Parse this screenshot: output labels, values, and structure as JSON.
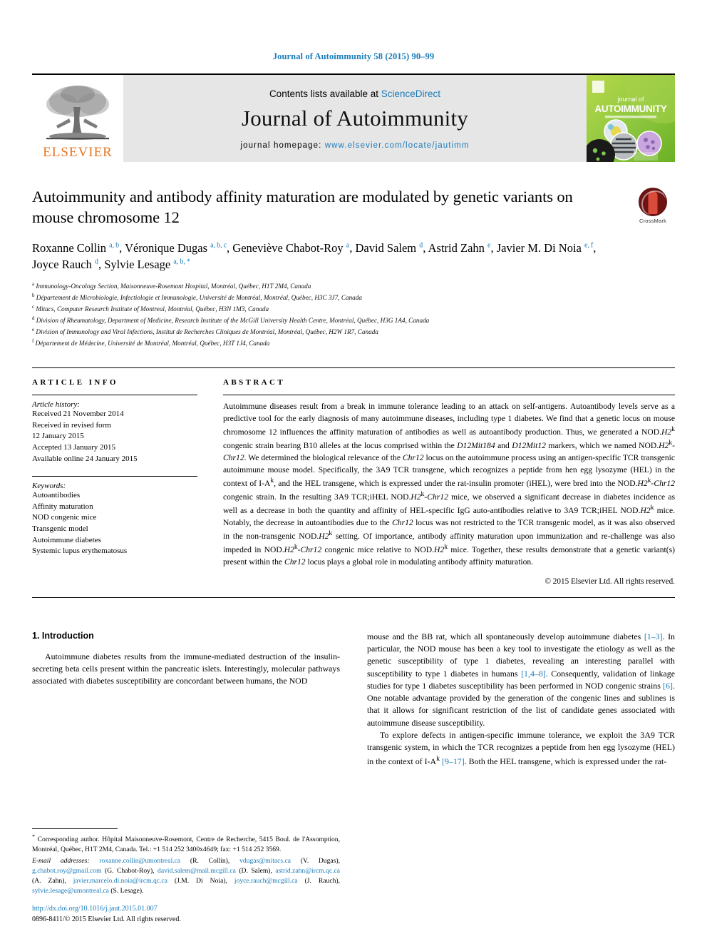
{
  "running_head": "Journal of Autoimmunity 58 (2015) 90–99",
  "masthead": {
    "contents_prefix": "Contents lists available at ",
    "sciencedirect": "ScienceDirect",
    "journal_title": "Journal of Autoimmunity",
    "homepage_prefix": "journal homepage: ",
    "homepage_url": "www.elsevier.com/locate/jautimm",
    "publisher": "ELSEVIER",
    "cover_line1": "journal of",
    "cover_line2": "AUTOIMMUNITY"
  },
  "article": {
    "title": "Autoimmunity and antibody affinity maturation are modulated by genetic variants on mouse chromosome 12",
    "crossmark_label": "CrossMark",
    "authors_html": "Roxanne Collin <sup>a, b</sup>, Véronique Dugas <sup>a, b, c</sup>, Geneviève Chabot-Roy <sup>a</sup>, David Salem <sup>d</sup>, Astrid Zahn <sup>e</sup>, Javier M. Di Noia <sup>e, f</sup>, Joyce Rauch <sup>d</sup>, Sylvie Lesage <sup>a, b, *</sup>",
    "affiliations": [
      {
        "mark": "a",
        "text": "Immunology-Oncology Section, Maisonneuve-Rosemont Hospital, Montréal, Québec, H1T 2M4, Canada"
      },
      {
        "mark": "b",
        "text": "Département de Microbiologie, Infectiologie et Immunologie, Université de Montréal, Montréal, Québec, H3C 3J7, Canada"
      },
      {
        "mark": "c",
        "text": "Mitacs, Computer Research Institute of Montreal, Montréal, Québec, H3N 1M3, Canada"
      },
      {
        "mark": "d",
        "text": "Division of Rheumatology, Department of Medicine, Research Institute of the McGill University Health Centre, Montréal, Québec, H3G 1A4, Canada"
      },
      {
        "mark": "e",
        "text": "Division of Immunology and Viral Infections, Institut de Recherches Cliniques de Montréal, Montréal, Québec, H2W 1R7, Canada"
      },
      {
        "mark": "f",
        "text": "Département de Médecine, Université de Montréal, Montréal, Québec, H3T 1J4, Canada"
      }
    ]
  },
  "article_info": {
    "heading": "ARTICLE INFO",
    "history_label": "Article history:",
    "history": [
      "Received 21 November 2014",
      "Received in revised form",
      "12 January 2015",
      "Accepted 13 January 2015",
      "Available online 24 January 2015"
    ],
    "keywords_label": "Keywords:",
    "keywords": [
      "Autoantibodies",
      "Affinity maturation",
      "NOD congenic mice",
      "Transgenic model",
      "Autoimmune diabetes",
      "Systemic lupus erythematosus"
    ]
  },
  "abstract": {
    "heading": "ABSTRACT",
    "body_html": "Autoimmune diseases result from a break in immune tolerance leading to an attack on self-antigens. Autoantibody levels serve as a predictive tool for the early diagnosis of many autoimmune diseases, including type 1 diabetes. We find that a genetic locus on mouse chromosome 12 influences the affinity maturation of antibodies as well as autoantibody production. Thus, we generated a NOD.<i>H2</i><sup>k</sup> congenic strain bearing B10 alleles at the locus comprised within the <i>D12Mit184</i> and <i>D12Mit12</i> markers, which we named NOD.<i>H2</i><sup>k</sup>-<i>Chr12</i>. We determined the biological relevance of the <i>Chr12</i> locus on the autoimmune process using an antigen-specific TCR transgenic autoimmune mouse model. Specifically, the 3A9 TCR transgene, which recognizes a peptide from hen egg lysozyme (HEL) in the context of I-A<sup>k</sup>, and the HEL transgene, which is expressed under the rat-insulin promoter (iHEL), were bred into the NOD.<i>H2</i><sup>k</sup>-<i>Chr12</i> congenic strain. In the resulting 3A9 TCR;iHEL NOD.<i>H2</i><sup>k</sup>-<i>Chr12</i> mice, we observed a significant decrease in diabetes incidence as well as a decrease in both the quantity and affinity of HEL-specific IgG auto-antibodies relative to 3A9 TCR;iHEL NOD.<i>H2</i><sup>k</sup> mice. Notably, the decrease in autoantibodies due to the <i>Chr12</i> locus was not restricted to the TCR transgenic model, as it was also observed in the non-transgenic NOD.<i>H2</i><sup>k</sup> setting. Of importance, antibody affinity maturation upon immunization and re-challenge was also impeded in NOD.<i>H2</i><sup>k</sup>-<i>Chr12</i> congenic mice relative to NOD.<i>H2</i><sup>k</sup> mice. Together, these results demonstrate that a genetic variant(s) present within the <i>Chr12</i> locus plays a global role in modulating antibody affinity maturation.",
    "copyright": "© 2015 Elsevier Ltd. All rights reserved."
  },
  "introduction": {
    "heading": "1. Introduction",
    "left_paragraph_html": "Autoimmune diabetes results from the immune-mediated destruction of the insulin-secreting beta cells present within the pancreatic islets. Interestingly, molecular pathways associated with diabetes susceptibility are concordant between humans, the NOD",
    "right_paragraph1_html": "mouse and the BB rat, which all spontaneously develop autoimmune diabetes <span class=\"ref\">[1–3]</span>. In particular, the NOD mouse has been a key tool to investigate the etiology as well as the genetic susceptibility of type 1 diabetes, revealing an interesting parallel with susceptibility to type 1 diabetes in humans <span class=\"ref\">[1,4–8]</span>. Consequently, validation of linkage studies for type 1 diabetes susceptibility has been performed in NOD congenic strains <span class=\"ref\">[6]</span>. One notable advantage provided by the generation of the congenic lines and sublines is that it allows for significant restriction of the list of candidate genes associated with autoimmune disease susceptibility.",
    "right_paragraph2_html": "To explore defects in antigen-specific immune tolerance, we exploit the 3A9 TCR transgenic system, in which the TCR recognizes a peptide from hen egg lysozyme (HEL) in the context of I-A<sup>k</sup> <span class=\"ref\">[9–17]</span>. Both the HEL transgene, which is expressed under the rat-"
  },
  "footnote": {
    "corresponding_html": "<span class=\"ast\">*</span> Corresponding author. Hôpital Maisonneuve-Rosemont, Centre de Recherche, 5415 Boul. de l'Assomption, Montréal, Québec, H1T 2M4, Canada. Tel.: +1 514 252 3400x4649; fax: +1 514 252 3569.",
    "emails_html": "<span class=\"fn-em\">E-mail addresses:</span> <span class=\"mail\">roxanne.collin@umontreal.ca</span> (R. Collin), <span class=\"mail\">vdugas@mitacs.ca</span> (V. Dugas), <span class=\"mail\">g.chabot.roy@gmail.com</span> (G. Chabot-Roy), <span class=\"mail\">david.salem@mail.mcgill.ca</span> (D. Salem), <span class=\"mail\">astrid.zahn@ircm.qc.ca</span> (A. Zahn), <span class=\"mail\">javier.marcelo.di.noia@ircm.qc.ca</span> (J.M. Di Noia), <span class=\"mail\">joyce.rauch@mcgill.ca</span> (J. Rauch), <span class=\"mail\">sylvie.lesage@umontreal.ca</span> (S. Lesage).",
    "doi": "http://dx.doi.org/10.1016/j.jaut.2015.01.007",
    "issn_copyright": "0896-8411/© 2015 Elsevier Ltd. All rights reserved."
  }
}
